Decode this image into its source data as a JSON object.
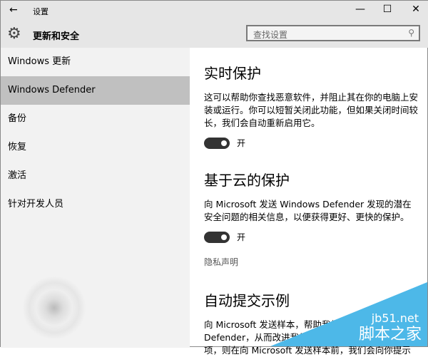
{
  "window": {
    "title": "设置",
    "back": "←",
    "minimize": "—",
    "maximize": "☐",
    "close": "✕"
  },
  "header": {
    "title": "更新和安全",
    "search_placeholder": "查找设置",
    "search_icon": "⚲",
    "gear_icon": "⚙"
  },
  "sidebar": {
    "items": [
      {
        "label": "Windows 更新"
      },
      {
        "label": "Windows Defender"
      },
      {
        "label": "备份"
      },
      {
        "label": "恢复"
      },
      {
        "label": "激活"
      },
      {
        "label": "针对开发人员"
      }
    ]
  },
  "main": {
    "realtime": {
      "title": "实时保护",
      "desc": "这可以帮助你查找恶意软件，并阻止其在你的电脑上安装或运行。你可以短暂关闭此功能，但如果关闭时间较长，我们会自动重新启用它。",
      "toggle": "开",
      "on": true
    },
    "cloud": {
      "title": "基于云的保护",
      "desc": "向 Microsoft 发送 Windows Defender 发现的潜在安全问题的相关信息，以便获得更好、更快的保护。",
      "toggle": "开",
      "on": true,
      "privacy": "隐私声明"
    },
    "sample": {
      "title": "自动提交示例",
      "desc": "向 Microsoft 发送样本，帮助我们改进 Windows Defender，从而改进我们的防病毒措施。如果关闭此项，则在向 Microsoft 发送样本前，我们会向你提示"
    }
  },
  "watermark": {
    "url": "jb51.net",
    "name": "脚本之家"
  }
}
